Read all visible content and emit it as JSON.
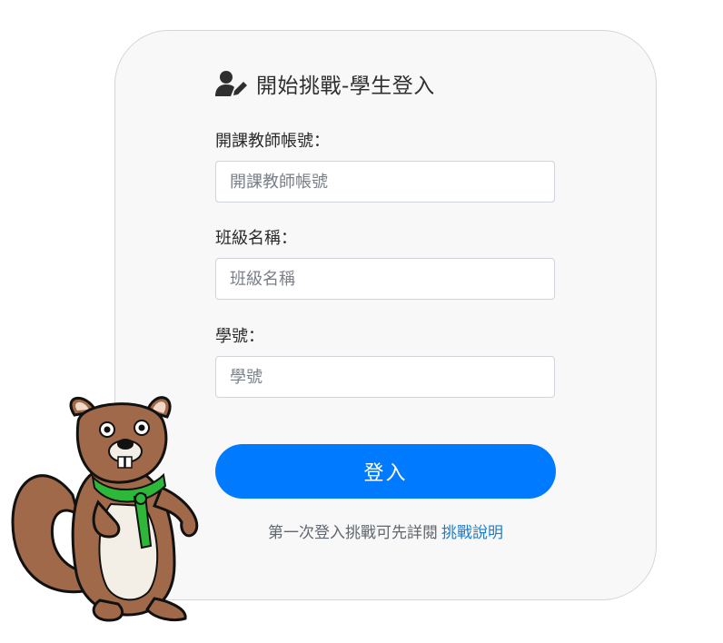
{
  "header": {
    "title": "開始挑戰-學生登入",
    "icon": "user-edit-icon"
  },
  "form": {
    "teacher_account": {
      "label": "開課教師帳號：",
      "placeholder": "開課教師帳號",
      "value": ""
    },
    "class_name": {
      "label": "班級名稱：",
      "placeholder": "班級名稱",
      "value": ""
    },
    "student_id": {
      "label": "學號：",
      "placeholder": "學號",
      "value": ""
    },
    "submit_label": "登入"
  },
  "footer": {
    "hint_text": "第一次登入挑戰可先詳閱",
    "link_text": "挑戰說明"
  },
  "mascot": {
    "icon": "beaver-mascot-illustration"
  },
  "colors": {
    "primary": "#007bff",
    "link": "#1e7ec8",
    "card_bg": "#f8f8f8",
    "mascot_fur": "#a0694a",
    "mascot_scarf": "#2eb83a"
  }
}
